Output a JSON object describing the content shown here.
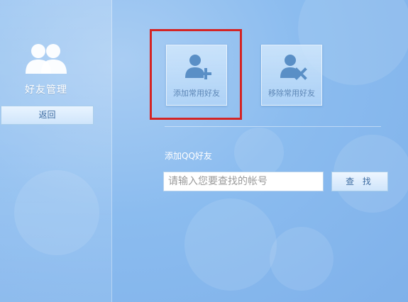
{
  "sidebar": {
    "icon": "friends-icon",
    "title": "好友管理",
    "back_label": "返回"
  },
  "actions": [
    {
      "label": "添加常用好友",
      "icon": "add-user-icon",
      "highlighted": true
    },
    {
      "label": "移除常用好友",
      "icon": "remove-user-icon",
      "highlighted": false
    }
  ],
  "add_qq": {
    "section_label": "添加QQ好友",
    "search_placeholder": "请输入您要查找的帐号",
    "search_value": "",
    "search_button_label": "查 找"
  },
  "colors": {
    "highlight_border": "#d42424",
    "icon_fill": "#ffffff",
    "tile_icon": "#5a8fc6",
    "background": "#8bbcef"
  }
}
